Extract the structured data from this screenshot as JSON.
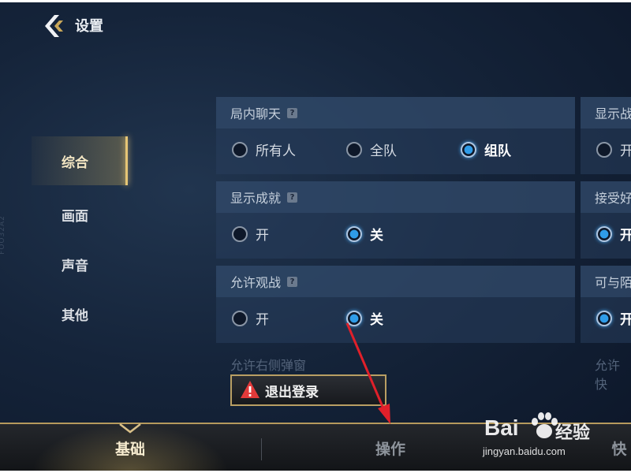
{
  "header": {
    "title": "设置",
    "side_id": "FOO32A2"
  },
  "sidebar": {
    "items": [
      {
        "label": "综合",
        "active": true
      },
      {
        "label": "画面",
        "active": false
      },
      {
        "label": "声音",
        "active": false
      },
      {
        "label": "其他",
        "active": false
      }
    ]
  },
  "settings": {
    "chat": {
      "title": "局内聊天",
      "options": [
        "所有人",
        "全队",
        "组队"
      ],
      "selected": "组队"
    },
    "achievements": {
      "title": "显示成就",
      "options": [
        "开",
        "关"
      ],
      "selected": "关"
    },
    "spectate": {
      "title": "允许观战",
      "options": [
        "开",
        "关"
      ],
      "selected": "关"
    },
    "partial_next": "允许右侧弹窗"
  },
  "right_column": {
    "rows": [
      {
        "title": "显示战",
        "option": "开",
        "selected": false
      },
      {
        "title": "接受好",
        "option": "开",
        "selected": true
      },
      {
        "title": "可与陌",
        "option": "开",
        "selected": true
      }
    ],
    "partial_next": "允许快"
  },
  "logout_label": "退出登录",
  "bottom_tabs": [
    {
      "label": "基础",
      "active": true
    },
    {
      "label": "操作",
      "active": false
    },
    {
      "label": "快",
      "active": false
    }
  ],
  "watermark": {
    "brand": "Bai",
    "cn": "经验",
    "url": "jingyan.baidu.com"
  },
  "colors": {
    "accent_gold": "#e6c676",
    "radio_selected": "#2f9ce8",
    "warning_red": "#e23a3a",
    "arrow": "#e0202a"
  },
  "icons": {
    "back": "back-chevron-icon",
    "help": "question-icon",
    "warning": "warning-triangle-icon",
    "paw": "baidu-paw-icon"
  }
}
